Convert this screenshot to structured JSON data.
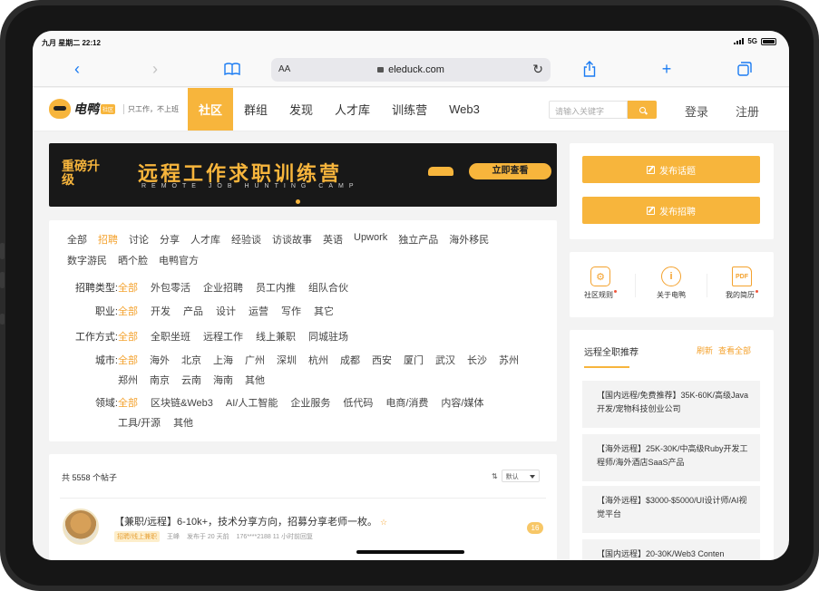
{
  "status": {
    "time": "九月 星期二 22:12",
    "network": "5G"
  },
  "browser": {
    "text_size": "AA",
    "url": "eleduck.com",
    "icons": {
      "back": "‹",
      "forward": "›",
      "bookmarks": "book-icon",
      "share": "share-icon",
      "new_tab": "+",
      "tabs": "tabs-icon"
    }
  },
  "site": {
    "logo_text": "电鸭",
    "logo_tag": "社区",
    "slogan": "只工作，不上班",
    "nav": [
      {
        "label": "社区",
        "active": true
      },
      {
        "label": "群组"
      },
      {
        "label": "发现"
      },
      {
        "label": "人才库"
      },
      {
        "label": "训练营"
      },
      {
        "label": "Web3"
      }
    ],
    "search_placeholder": "请输入关键字",
    "login": "登录",
    "register": "注册"
  },
  "banner": {
    "badge": "重磅升级",
    "title": "远程工作求职训练营",
    "subtitle": "REMOTE JOB HUNTING CAMP",
    "cta": "立即查看"
  },
  "topics": [
    "全部",
    "招聘",
    "讨论",
    "分享",
    "人才库",
    "经验谈",
    "访谈故事",
    "英语",
    "Upwork",
    "独立产品",
    "海外移民",
    "数字游民",
    "晒个脸",
    "电鸭官方"
  ],
  "active_topic": "招聘",
  "filters": {
    "type": {
      "label": "招聘类型:",
      "options": [
        "全部",
        "外包零活",
        "企业招聘",
        "员工内推",
        "组队合伙"
      ]
    },
    "job": {
      "label": "职业:",
      "options": [
        "全部",
        "开发",
        "产品",
        "设计",
        "运营",
        "写作",
        "其它"
      ]
    },
    "mode": {
      "label": "工作方式:",
      "options": [
        "全部",
        "全职坐班",
        "远程工作",
        "线上兼职",
        "同城驻场"
      ]
    },
    "city": {
      "label": "城市:",
      "options": [
        "全部",
        "海外",
        "北京",
        "上海",
        "广州",
        "深圳",
        "杭州",
        "成都",
        "西安",
        "厦门",
        "武汉",
        "长沙",
        "苏州",
        "郑州",
        "南京",
        "云南",
        "海南",
        "其他"
      ]
    },
    "field": {
      "label": "领域:",
      "options": [
        "全部",
        "区块链&Web3",
        "AI/人工智能",
        "企业服务",
        "低代码",
        "电商/消费",
        "内容/媒体",
        "工具/开源",
        "其他"
      ]
    }
  },
  "posts": {
    "count_text": "共 5558 个帖子",
    "sort_value": "默认",
    "items": [
      {
        "title": "【兼职/远程】6-10k+，技术分享方向，招募分享老师一枚。",
        "tag": "招聘/线上兼职",
        "author": "王峰",
        "posted": "发布于 20 天前",
        "last_reply": "176****2188 11 小时前回复",
        "replies": "16"
      }
    ]
  },
  "sidebar": {
    "post_topic": "发布话题",
    "post_job": "发布招聘",
    "quick_links": [
      {
        "label": "社区规则",
        "icon": "gear-icon",
        "dot": true
      },
      {
        "label": "关于电鸭",
        "icon": "info-icon",
        "dot": false
      },
      {
        "label": "我的简历",
        "icon": "pdf-icon",
        "dot": true
      }
    ],
    "recommend_title": "远程全职推荐",
    "refresh": "刷新",
    "view_all": "查看全部",
    "recommendations": [
      "【国内远程/免费推荐】35K-60K/高级Java开发/宠物科技创业公司",
      "【海外远程】25K-30K/中高级Ruby开发工程师/海外酒店SaaS产品",
      "【海外远程】$3000-$5000/UI设计师/AI视觉平台",
      "【国内远程】20-30K/Web3 Conten"
    ]
  }
}
